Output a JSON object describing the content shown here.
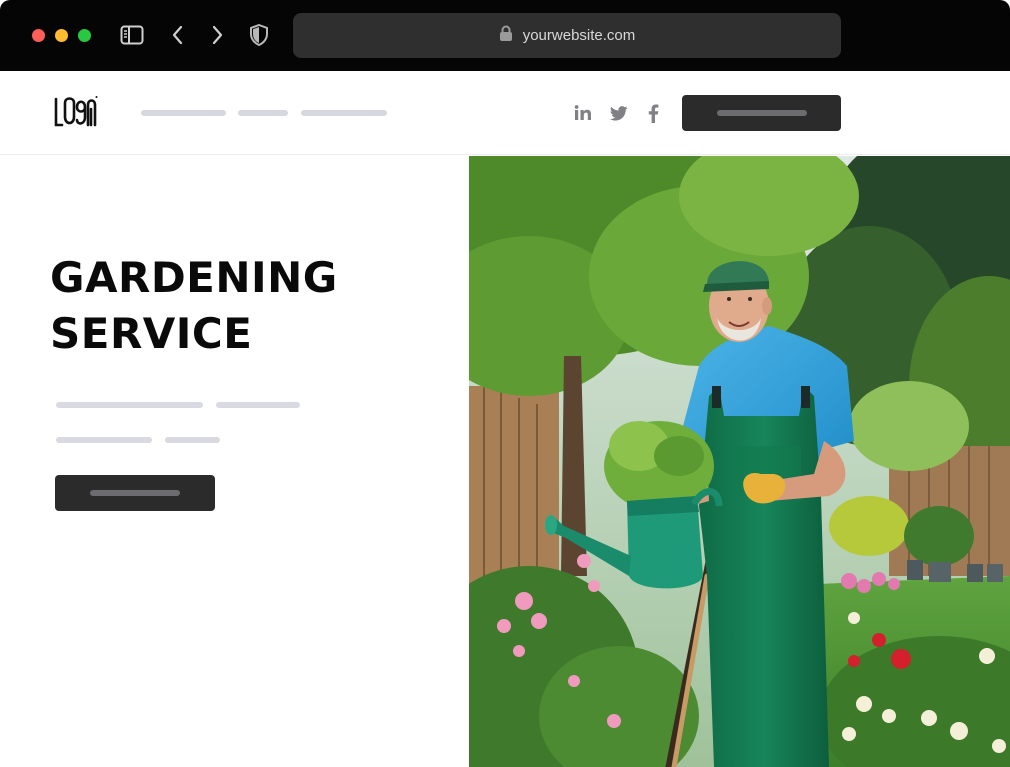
{
  "browser": {
    "url": "yourwebsite.com",
    "icons": [
      "sidebar-icon",
      "back-icon",
      "forward-icon",
      "shield-icon",
      "lock-icon"
    ]
  },
  "header": {
    "logo_text": "LOGO",
    "social_icons": [
      "linkedin-icon",
      "twitter-icon",
      "facebook-icon"
    ]
  },
  "hero": {
    "title_line1": "GARDENING",
    "title_line2": "SERVICE"
  },
  "colors": {
    "chrome_bg": "#050505",
    "urlbar_bg": "#2f2f2f",
    "button_bg": "#2b2b2b",
    "placeholder_line": "#d9d9e2",
    "text_dark": "#0a0a0a"
  }
}
